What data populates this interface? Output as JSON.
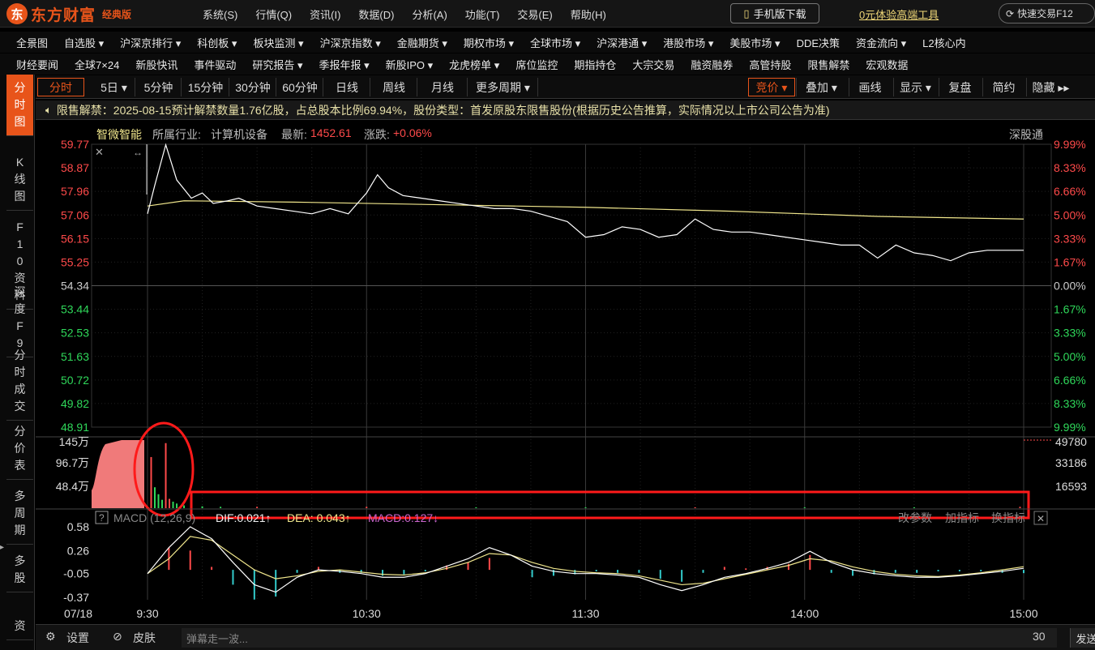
{
  "titlebar": {
    "brand": "东方财富",
    "edition": "经典版",
    "menus": [
      "系统(S)",
      "行情(Q)",
      "资讯(I)",
      "数据(D)",
      "分析(A)",
      "功能(T)",
      "交易(E)",
      "帮助(H)"
    ],
    "mobile_download": "手机版下载",
    "promo": "0元体验高端工具",
    "quick_trade": "快速交易F12"
  },
  "nav_row1": [
    "全景图",
    "自选股 ▾",
    "沪深京排行 ▾",
    "科创板 ▾",
    "板块监测 ▾",
    "沪深京指数 ▾",
    "金融期货 ▾",
    "期权市场 ▾",
    "全球市场 ▾",
    "沪深港通 ▾",
    "港股市场 ▾",
    "美股市场 ▾",
    "DDE决策",
    "资金流向 ▾",
    "L2核心内"
  ],
  "nav_row2": [
    "财经要闻",
    "全球7×24",
    "新股快讯",
    "事件驱动",
    "研究报告 ▾",
    "季报年报 ▾",
    "新股IPO ▾",
    "龙虎榜单 ▾",
    "席位监控",
    "期指持仓",
    "大宗交易",
    "融资融券",
    "高管持股",
    "限售解禁",
    "宏观数据"
  ],
  "left_tabs": [
    "分时图",
    "K线图",
    "F10资料",
    "深度F9",
    "分时成交",
    "分价表",
    "多周期",
    "多股",
    "资"
  ],
  "period_tabs": [
    "分时",
    "5日 ▾",
    "5分钟",
    "15分钟",
    "30分钟",
    "60分钟",
    "日线",
    "周线",
    "月线",
    "更多周期 ▾"
  ],
  "right_tabs": [
    "竞价 ▾",
    "叠加 ▾",
    "画线",
    "显示 ▾",
    "复盘",
    "简约",
    "隐藏 ▸▸"
  ],
  "notice": "限售解禁：2025-08-15预计解禁数量1.76亿股，占总股本比例69.94%，股份类型：首发原股东限售股份(根据历史公告推算，实际情况以上市公司公告为准)",
  "stock": {
    "name": "智微智能",
    "industry_label": "所属行业:",
    "industry": "计算机设备",
    "latest_label": "最新:",
    "latest": "1452.61",
    "change_label": "涨跌:",
    "change": "+0.06%",
    "connect": "深股通"
  },
  "macd": {
    "title": "MACD (12,26,9)",
    "dif": "DIF:0.021↑",
    "dea": "DEA: 0.043↑",
    "macd": "MACD:0.127↓",
    "actions": [
      "改参数",
      "加指标",
      "换指标"
    ]
  },
  "bottom": {
    "settings": "设置",
    "skin": "皮肤",
    "danmu_placeholder": "弹幕走一波...",
    "count": "30",
    "send": "发送"
  },
  "colors": {
    "up": "#ff4a4a",
    "down": "#2fd85a",
    "accent": "#e8541a",
    "price_line": "#ffffff",
    "avg_line": "#f0e68c",
    "annotation": "#ff1a1a"
  },
  "chart_data": [
    {
      "type": "line",
      "title": "智微智能 分时",
      "y_left_ticks": [
        "59.77",
        "58.87",
        "57.96",
        "57.06",
        "56.15",
        "55.25",
        "54.34",
        "53.44",
        "52.53",
        "51.63",
        "50.72",
        "49.82",
        "48.91"
      ],
      "y_right_ticks": [
        "9.99%",
        "8.33%",
        "6.66%",
        "5.00%",
        "3.33%",
        "1.67%",
        "0.00%",
        "1.67%",
        "3.33%",
        "5.00%",
        "6.66%",
        "8.33%",
        "9.99%"
      ],
      "ylim": [
        48.91,
        59.77
      ],
      "prev_close": 54.34,
      "x_ticks": [
        "07/18",
        "9:30",
        "10:30",
        "11:30",
        "14:00",
        "15:00"
      ],
      "series": [
        {
          "name": "price",
          "x": [
            0,
            2,
            5,
            8,
            12,
            15,
            18,
            22,
            25,
            30,
            35,
            40,
            45,
            50,
            55,
            60,
            63,
            66,
            70,
            75,
            80,
            85,
            90,
            95,
            100,
            105,
            110,
            115,
            120,
            125,
            130,
            135,
            140,
            145,
            150,
            155,
            160,
            165,
            170,
            175,
            180,
            185,
            190,
            195,
            200,
            205,
            210,
            215,
            220,
            225,
            230,
            235,
            240
          ],
          "values": [
            57.1,
            58.2,
            59.75,
            58.4,
            57.7,
            57.9,
            57.5,
            57.6,
            57.7,
            57.4,
            57.3,
            57.2,
            57.1,
            57.3,
            57.1,
            57.9,
            58.6,
            58.1,
            57.8,
            57.7,
            57.6,
            57.5,
            57.4,
            57.3,
            57.3,
            57.2,
            57.0,
            56.8,
            56.2,
            56.3,
            56.6,
            56.5,
            56.2,
            56.3,
            56.9,
            56.5,
            56.4,
            56.4,
            56.3,
            56.2,
            56.1,
            56.0,
            55.9,
            55.9,
            55.4,
            55.9,
            55.6,
            55.5,
            55.3,
            55.6,
            55.7,
            55.7,
            55.7
          ]
        },
        {
          "name": "average",
          "x": [
            0,
            10,
            40,
            80,
            120,
            160,
            200,
            240
          ],
          "values": [
            57.4,
            57.6,
            57.55,
            57.45,
            57.35,
            57.2,
            57.0,
            56.9
          ]
        }
      ]
    },
    {
      "type": "bar",
      "title": "成交量",
      "y_left_ticks": [
        "145万",
        "96.7万",
        "48.4万"
      ],
      "y_right_ticks": [
        "49780",
        "33186",
        "16593"
      ],
      "auction_peak": 145,
      "bars": [
        {
          "x": 1,
          "v": 110,
          "dir": "up"
        },
        {
          "x": 2,
          "v": 45,
          "dir": "down"
        },
        {
          "x": 3,
          "v": 30,
          "dir": "down"
        },
        {
          "x": 4,
          "v": 18,
          "dir": "down"
        },
        {
          "x": 5,
          "v": 140,
          "dir": "up"
        },
        {
          "x": 6,
          "v": 20,
          "dir": "up"
        },
        {
          "x": 7,
          "v": 14,
          "dir": "down"
        },
        {
          "x": 8,
          "v": 10,
          "dir": "down"
        },
        {
          "x": 10,
          "v": 6,
          "dir": "down"
        },
        {
          "x": 12,
          "v": 5,
          "dir": "up"
        },
        {
          "x": 15,
          "v": 4,
          "dir": "down"
        },
        {
          "x": 20,
          "v": 3,
          "dir": "down"
        },
        {
          "x": 30,
          "v": 3,
          "dir": "up"
        },
        {
          "x": 60,
          "v": 3,
          "dir": "up"
        },
        {
          "x": 90,
          "v": 2,
          "dir": "down"
        },
        {
          "x": 120,
          "v": 2,
          "dir": "down"
        },
        {
          "x": 150,
          "v": 2,
          "dir": "up"
        },
        {
          "x": 180,
          "v": 2,
          "dir": "down"
        },
        {
          "x": 210,
          "v": 2,
          "dir": "down"
        },
        {
          "x": 239,
          "v": 3,
          "dir": "up"
        }
      ]
    },
    {
      "type": "bar",
      "title": "MACD (12,26,9)",
      "y_ticks": [
        "0.58",
        "0.26",
        "-0.05",
        "-0.37"
      ],
      "ylim": [
        -0.37,
        0.58
      ],
      "dif": [
        -0.05,
        0.3,
        0.58,
        0.42,
        0.1,
        -0.2,
        -0.3,
        -0.1,
        0.0,
        -0.02,
        -0.05,
        -0.1,
        -0.1,
        -0.05,
        0.05,
        0.15,
        0.3,
        0.2,
        0.05,
        -0.02,
        -0.05,
        -0.05,
        -0.07,
        -0.1,
        -0.2,
        -0.28,
        -0.2,
        -0.1,
        -0.05,
        0.02,
        0.1,
        0.25,
        0.1,
        0.0,
        -0.05,
        -0.08,
        -0.1,
        -0.1,
        -0.08,
        -0.05,
        -0.02,
        0.021
      ],
      "dea": [
        -0.05,
        0.15,
        0.45,
        0.4,
        0.2,
        0.0,
        -0.12,
        -0.08,
        -0.02,
        0.0,
        -0.03,
        -0.06,
        -0.07,
        -0.04,
        0.02,
        0.1,
        0.22,
        0.2,
        0.1,
        0.02,
        -0.02,
        -0.04,
        -0.05,
        -0.08,
        -0.14,
        -0.2,
        -0.18,
        -0.12,
        -0.06,
        0.0,
        0.06,
        0.15,
        0.12,
        0.04,
        -0.02,
        -0.06,
        -0.08,
        -0.09,
        -0.07,
        -0.04,
        0.0,
        0.043
      ]
    }
  ]
}
